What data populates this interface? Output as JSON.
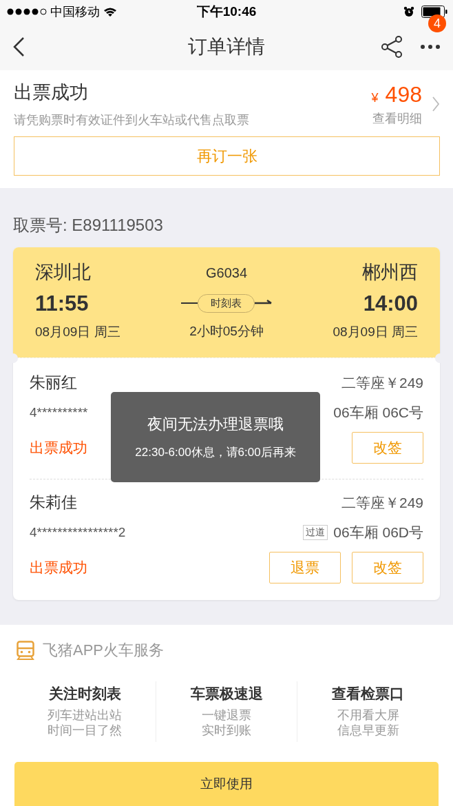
{
  "status_bar": {
    "carrier": "中国移动",
    "time": "下午10:46"
  },
  "nav": {
    "title": "订单详情",
    "badge": "4"
  },
  "order": {
    "status": "出票成功",
    "note": "请凭购票时有效证件到火车站或代售点取票",
    "currency": "¥",
    "price": "498",
    "detail_label": "查看明细",
    "rebook_button": "再订一张"
  },
  "pickup_code": "取票号: E891119503",
  "trip": {
    "from_station": "深圳北",
    "train_no": "G6034",
    "to_station": "郴州西",
    "depart_time": "11:55",
    "schedule_button": "时刻表",
    "arrive_time": "14:00",
    "depart_date": "08月09日 周三",
    "duration": "2小时05分钟",
    "arrive_date": "08月09日 周三"
  },
  "passengers": [
    {
      "name": "朱丽红",
      "fare": "二等座￥249",
      "id_number": "4**********",
      "seat": "06车厢 06C号",
      "status": "出票成功",
      "buttons": [
        "改签"
      ]
    },
    {
      "name": "朱莉佳",
      "fare": "二等座￥249",
      "id_number": "4****************2",
      "seat_tag": "过道",
      "seat": "06车厢 06D号",
      "status": "出票成功",
      "buttons": [
        "退票",
        "改签"
      ]
    }
  ],
  "toast": {
    "title": "夜间无法办理退票哦",
    "message": "22:30-6:00休息，请6:00后再来"
  },
  "service": {
    "title": "飞猪APP火车服务",
    "features": [
      {
        "title": "关注时刻表",
        "lines": [
          "列车进站出站",
          "时间一目了然"
        ]
      },
      {
        "title": "车票极速退",
        "lines": [
          "一键退票",
          "实时到账"
        ]
      },
      {
        "title": "查看检票口",
        "lines": [
          "不用看大屏",
          "信息早更新"
        ]
      }
    ],
    "button": "立即使用"
  }
}
